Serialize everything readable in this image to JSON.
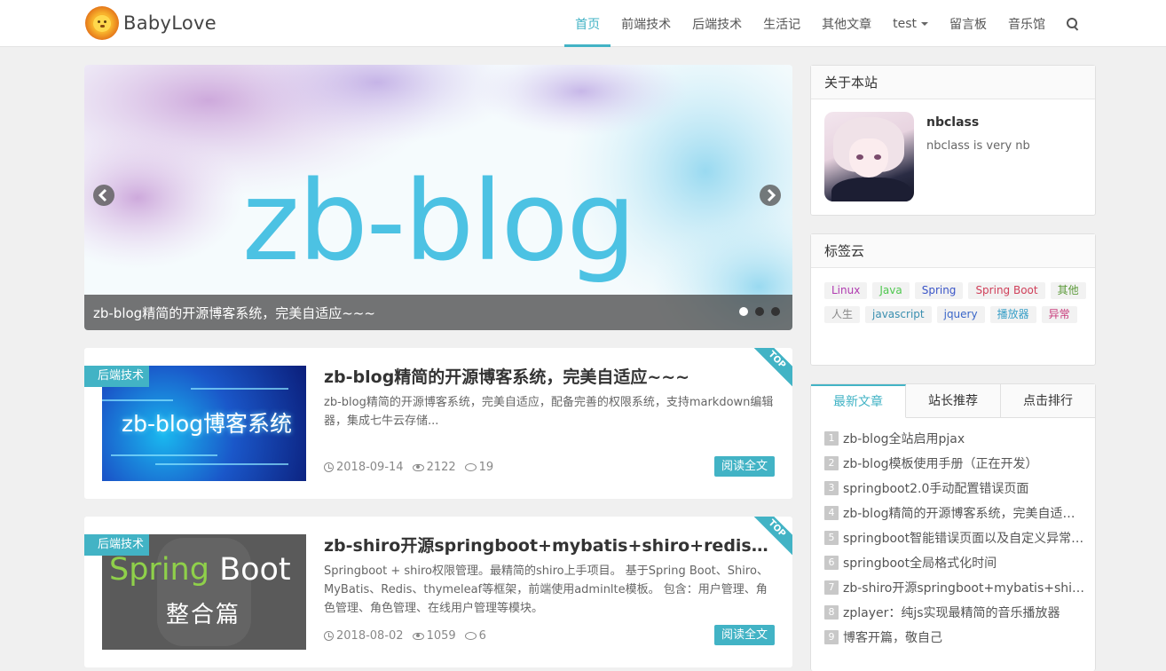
{
  "brand": {
    "name": "BabyLove"
  },
  "nav": {
    "items": [
      "首页",
      "前端技术",
      "后端技术",
      "生活记",
      "其他文章",
      "test",
      "留言板",
      "音乐馆"
    ],
    "active_index": 0
  },
  "carousel": {
    "image_text": "zb-blog",
    "caption": "zb-blog精简的开源博客系统，完美自适应~~~",
    "slide_count": 3,
    "active_slide": 0
  },
  "articles": [
    {
      "category": "后端技术",
      "badge": "TOP",
      "thumb_text": "zb-blog博客系统",
      "title": "zb-blog精简的开源博客系统，完美自适应~~~",
      "desc": "zb-blog精简的开源博客系统，完美自适应，配备完善的权限系统，支持markdown编辑器，集成七牛云存储...",
      "date": "2018-09-14",
      "views": "2122",
      "comments": "19",
      "read_label": "阅读全文"
    },
    {
      "category": "后端技术",
      "badge": "TOP",
      "thumb_text_1": "Spring",
      "thumb_text_2": "Boot",
      "thumb_text_3": "整合篇",
      "title": "zb-shiro开源springboot+mybatis+shiro+redis整合…",
      "desc": "Springboot + shiro权限管理。最精简的shiro上手项目。 基于Spring Boot、Shiro、MyBatis、Redis、thymeleaf等框架，前端使用adminlte模板。 包含：用户管理、角色管理、角色管理、在线用户管理等模块。",
      "date": "2018-08-02",
      "views": "1059",
      "comments": "6",
      "read_label": "阅读全文"
    }
  ],
  "about": {
    "title": "关于本站",
    "name": "nbclass",
    "desc": "nbclass is very nb"
  },
  "tag_cloud": {
    "title": "标签云",
    "tags": [
      {
        "label": "Linux",
        "color": "#b03ab0"
      },
      {
        "label": "Java",
        "color": "#4fc84f"
      },
      {
        "label": "Spring",
        "color": "#3a55c8"
      },
      {
        "label": "Spring Boot",
        "color": "#d0405a"
      },
      {
        "label": "其他",
        "color": "#5c9a3a"
      },
      {
        "label": "人生",
        "color": "#888888"
      },
      {
        "label": "javascript",
        "color": "#3a8fb0"
      },
      {
        "label": "jquery",
        "color": "#3a66c8"
      },
      {
        "label": "播放器",
        "color": "#3aa0c8"
      },
      {
        "label": "异常",
        "color": "#c83a7a"
      }
    ]
  },
  "article_tabs": {
    "tabs": [
      "最新文章",
      "站长推荐",
      "点击排行"
    ],
    "active_index": 0,
    "items": [
      {
        "num": "1",
        "text": "zb-blog全站启用pjax"
      },
      {
        "num": "2",
        "text": "zb-blog模板使用手册（正在开发）"
      },
      {
        "num": "3",
        "text": "springboot2.0手动配置错误页面"
      },
      {
        "num": "4",
        "text": "zb-blog精简的开源博客系统，完美自适应~~~"
      },
      {
        "num": "5",
        "text": "springboot智能错误页面以及自定义异常处理"
      },
      {
        "num": "6",
        "text": "springboot全局格式化时间"
      },
      {
        "num": "7",
        "text": "zb-shiro开源springboot+mybatis+shiro+redis整合"
      },
      {
        "num": "8",
        "text": "zplayer：纯js实现最精简的音乐播放器"
      },
      {
        "num": "9",
        "text": "博客开篇，敬自己"
      }
    ]
  },
  "colors": {
    "accent": "#42b3c5"
  },
  "icons": [
    "search-icon",
    "clock-icon",
    "eye-icon",
    "comment-icon",
    "chevron-left-icon",
    "chevron-right-icon"
  ]
}
